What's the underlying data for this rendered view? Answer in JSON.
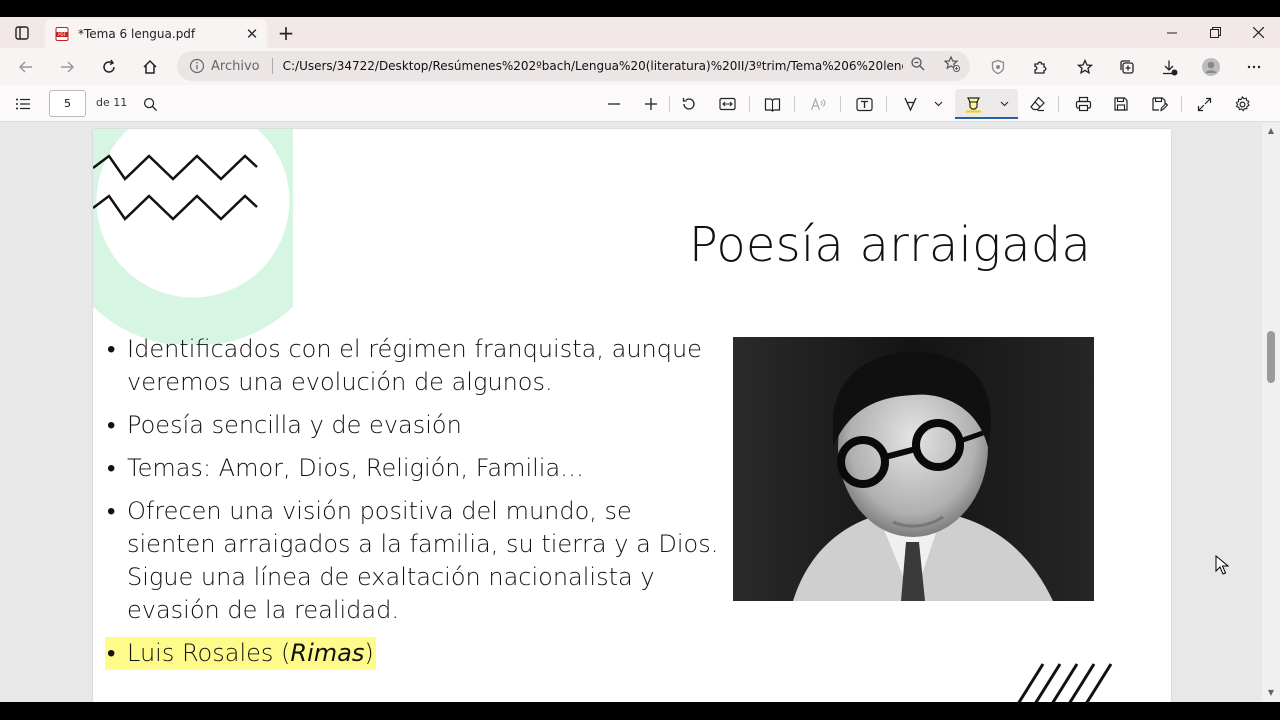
{
  "tab": {
    "title": "*Tema 6 lengua.pdf",
    "close": "✕",
    "new_tab": "+"
  },
  "window": {
    "minimize": "—",
    "restore": "❐",
    "close": "✕"
  },
  "address": {
    "scheme_label": "Archivo",
    "url": "C:/Users/34722/Desktop/Resúmenes%202ºbach/Lengua%20(literatura)%20II/3ºtrim/Tema%206%20lengu..."
  },
  "pdf_toolbar": {
    "page_number": "5",
    "page_of": "de 11"
  },
  "slide": {
    "title": "Poesía arraigada",
    "bullets": [
      "Identificados con el régimen franquista, aunque veremos una evolución de algunos.",
      "Poesía sencilla y de evasión",
      "Temas: Amor, Dios, Religión, Familia…",
      "Ofrecen una visión positiva del mundo, se sienten arraigados a la familia, su tierra y a Dios. Sigue una línea de exaltación nacionalista y evasión de la realidad."
    ],
    "highlight_bullet": {
      "name": "Luis Rosales (",
      "work": "Rimas",
      "close": ")"
    }
  },
  "colors": {
    "accent_green": "#d6f5e3",
    "highlight_yellow": "#fffb8a",
    "active_tool_underline": "#2360a6"
  }
}
